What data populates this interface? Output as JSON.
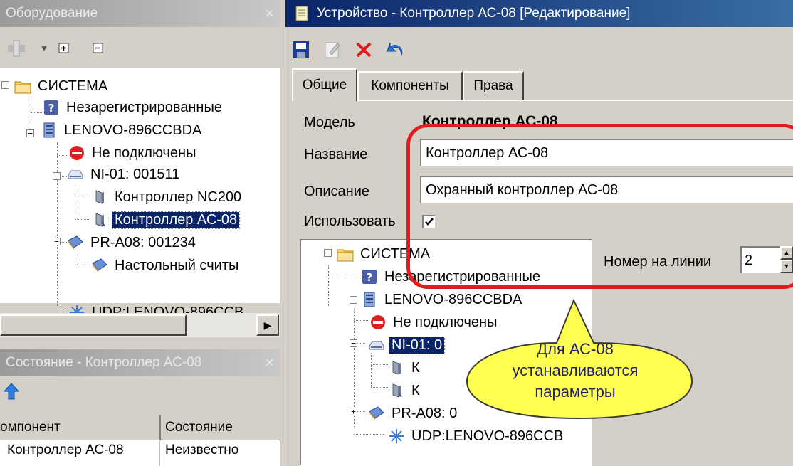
{
  "equipment_panel": {
    "title": "Оборудование",
    "close": "×",
    "tree": [
      {
        "label": "СИСТЕМА",
        "icon": "folder-icon"
      },
      {
        "label": "Незарегистрированные",
        "icon": "question-icon"
      },
      {
        "label": "LENOVO-896CCBDA",
        "icon": "server-icon"
      },
      {
        "label": "Не подключены",
        "icon": "stop-icon"
      },
      {
        "label": "NI-01: 001511",
        "icon": "network-device-icon"
      },
      {
        "label": "Контроллер NC200",
        "icon": "controller-icon"
      },
      {
        "label": "Контроллер АС-08",
        "icon": "controller-icon",
        "selected": true
      },
      {
        "label": "PR-A08: 001234",
        "icon": "reader-icon"
      },
      {
        "label": "Настольный считы",
        "icon": "reader-icon"
      },
      {
        "label": "UDP:LENOVO-896CCB",
        "icon": "udp-icon"
      }
    ]
  },
  "status_panel": {
    "title": "Состояние - Контроллер АС-08",
    "close": "×",
    "columns": [
      "омпонент",
      "Состояние"
    ],
    "rows": [
      [
        "Контроллер АС-08",
        "Неизвестно"
      ]
    ]
  },
  "device_window": {
    "title": "Устройство - Контроллер АС-08 [Редактирование]",
    "toolbar": [
      "save-icon",
      "edit-icon",
      "delete-icon",
      "undo-icon"
    ],
    "tabs": [
      "Общие",
      "Компоненты",
      "Права"
    ],
    "active_tab": "Общие",
    "form": {
      "model_label": "Модель",
      "model_value": "Контроллер АС-08",
      "name_label": "Название",
      "name_value": "Контроллер АС-08",
      "desc_label": "Описание",
      "desc_value": "Охранный контроллер АС-08",
      "use_label": "Использовать",
      "use_checked": true,
      "line_label": "Номер на линии",
      "line_value": "2"
    },
    "tree": [
      {
        "label": "СИСТЕМА",
        "icon": "folder-icon"
      },
      {
        "label": "Незарегистрированные",
        "icon": "question-icon"
      },
      {
        "label": "LENOVO-896CCBDA",
        "icon": "server-icon"
      },
      {
        "label": "Не подключены",
        "icon": "stop-icon"
      },
      {
        "label": "NI-01: 0",
        "icon": "network-device-icon",
        "selected": true
      },
      {
        "label": "К",
        "icon": "controller-icon"
      },
      {
        "label": "К",
        "icon": "controller-icon"
      },
      {
        "label": "PR-A08: 0",
        "icon": "reader-icon"
      },
      {
        "label": "UDP:LENOVO-896CCB",
        "icon": "udp-icon"
      }
    ]
  },
  "callout": {
    "line1": "Для АС-08",
    "line2": "устанавливаются",
    "line3": "параметры"
  },
  "colors": {
    "highlight": "#e41b1b",
    "callout_fill": "#ffff4f",
    "selection": "#0a246a"
  }
}
